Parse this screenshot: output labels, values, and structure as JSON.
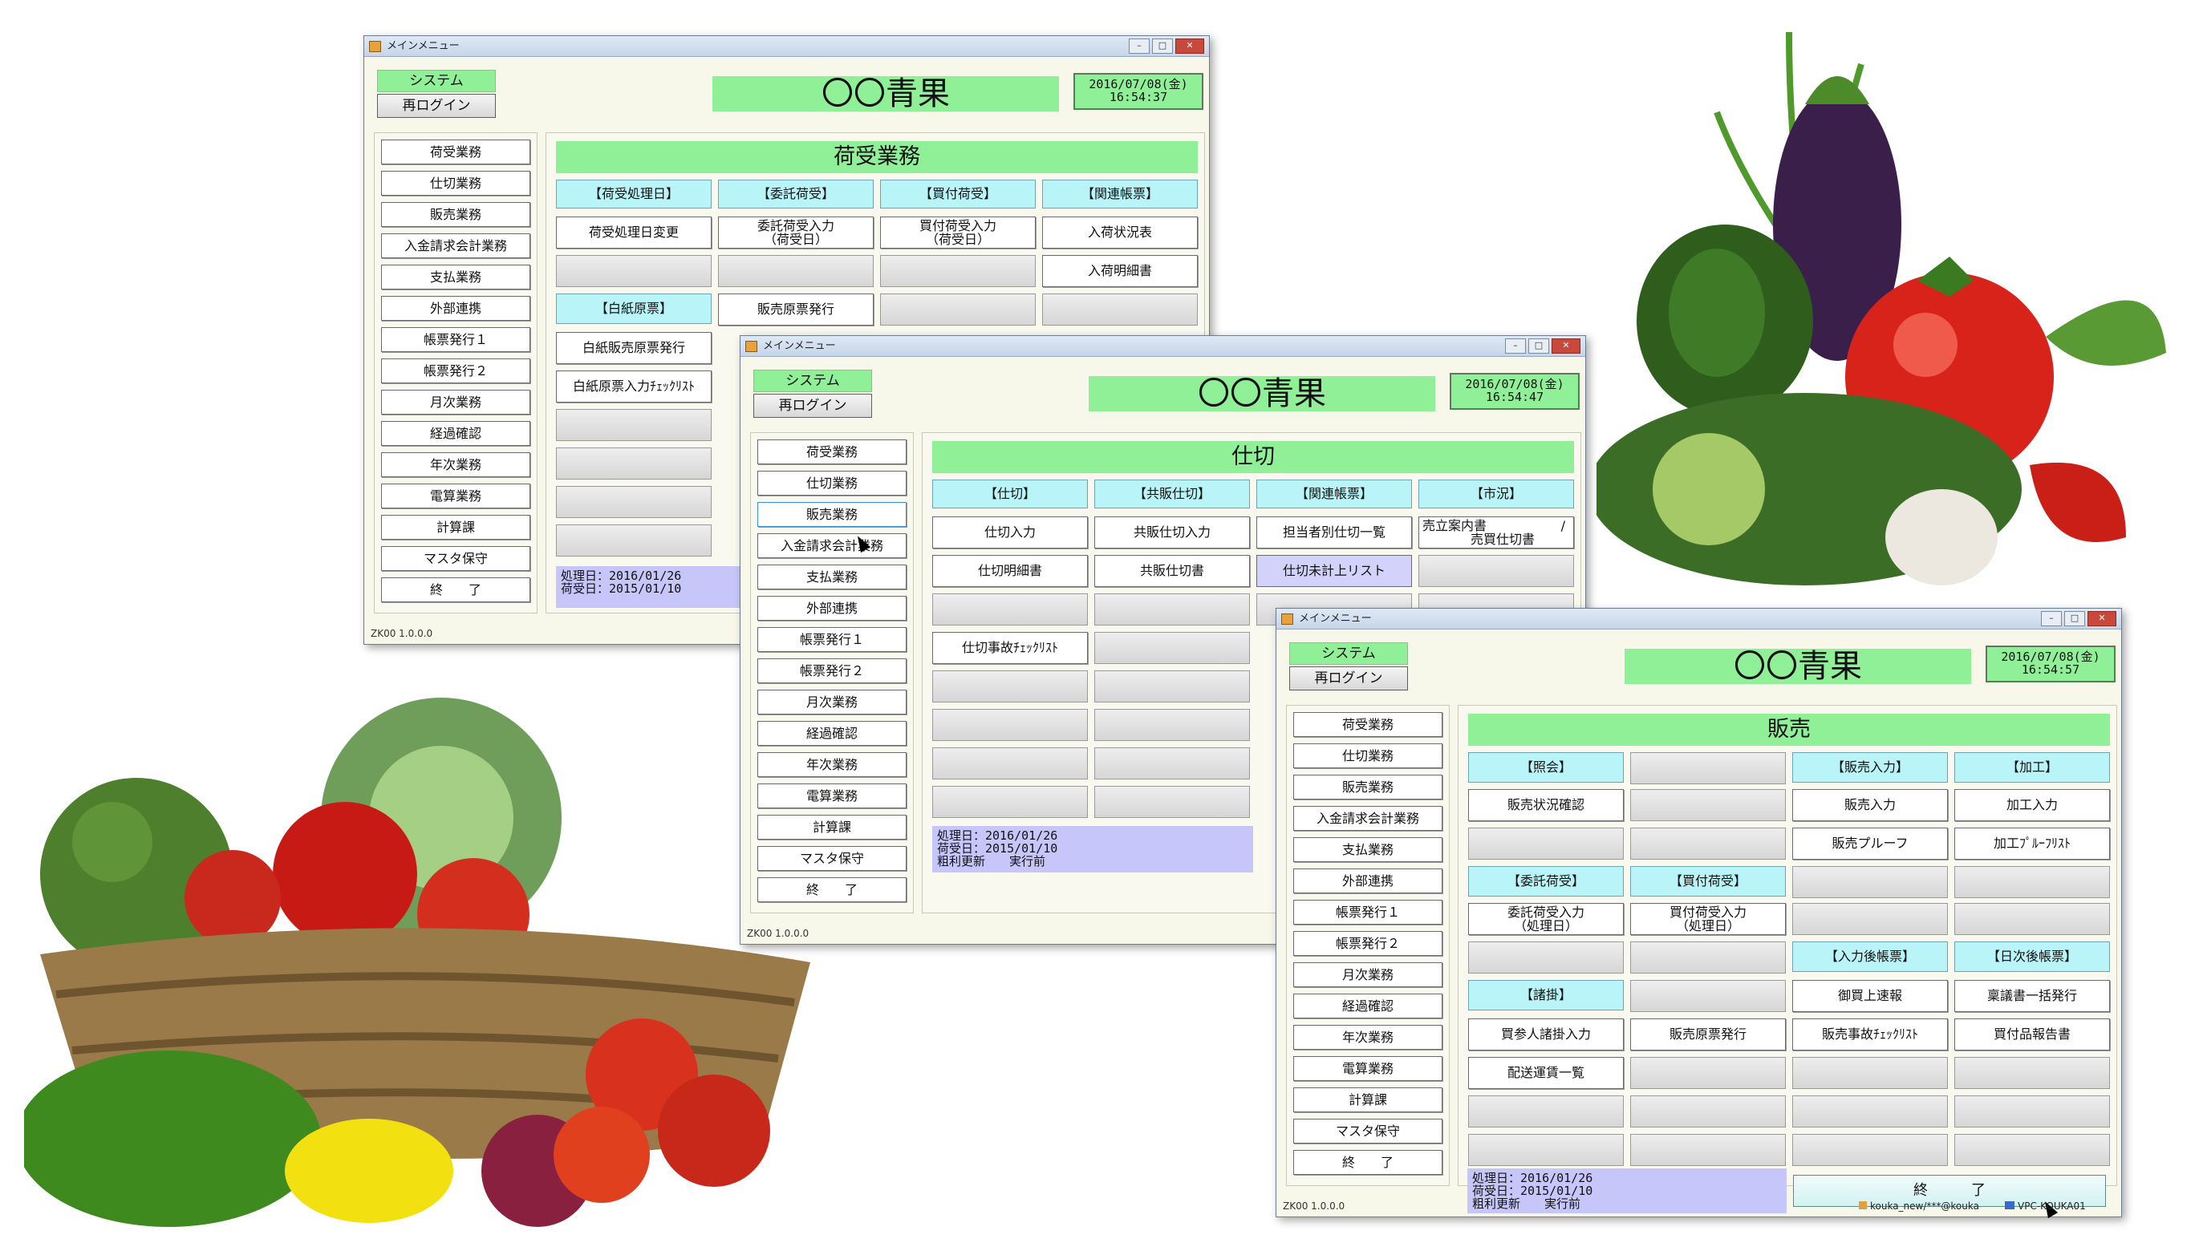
{
  "win1": {
    "title": "メインメニュー",
    "system_label": "システム",
    "relogin_label": "再ログイン",
    "company": "〇〇青果",
    "clock": [
      "2016/07/08(金)",
      "16:54:37"
    ],
    "menu": [
      "荷受業務",
      "仕切業務",
      "販売業務",
      "入金請求会計業務",
      "支払業務",
      "外部連携",
      "帳票発行１",
      "帳票発行２",
      "月次業務",
      "経過確認",
      "年次業務",
      "電算業務",
      "計算課",
      "マスタ保守",
      "終　　了"
    ],
    "section_title": "荷受業務",
    "cells": {
      "c0_0": "【荷受処理日】",
      "c0_1": "【委託荷受】",
      "c0_2": "【買付荷受】",
      "c0_3": "【関連帳票】",
      "c1_0": "荷受処理日変更",
      "c1_1a": "委託荷受入力",
      "c1_1b": "（荷受日）",
      "c1_2a": "買付荷受入力",
      "c1_2b": "（荷受日）",
      "c1_3": "入荷状況表",
      "c2_3": "入荷明細書",
      "c3_0": "【白紙原票】",
      "c3_1": "販売原票発行",
      "c4_0": "白紙販売原票発行",
      "c5_0": "白紙原票入力ﾁｪｯｸﾘｽﾄ"
    },
    "status": [
      "処理日：2016/01/26",
      "荷受日：2015/01/10"
    ],
    "version": "ZK00  1.0.0.0"
  },
  "win2": {
    "title": "メインメニュー",
    "system_label": "システム",
    "relogin_label": "再ログイン",
    "company": "〇〇青果",
    "clock": [
      "2016/07/08(金)",
      "16:54:47"
    ],
    "menu": [
      "荷受業務",
      "仕切業務",
      "販売業務",
      "入金請求会計業務",
      "支払業務",
      "外部連携",
      "帳票発行１",
      "帳票発行２",
      "月次業務",
      "経過確認",
      "年次業務",
      "電算業務",
      "計算課",
      "マスタ保守",
      "終　　了"
    ],
    "section_title": "仕切",
    "cells": {
      "c0_0": "【仕切】",
      "c0_1": "【共販仕切】",
      "c0_2": "【関連帳票】",
      "c0_3": "【市況】",
      "c1_0": "仕切入力",
      "c1_1": "共販仕切入力",
      "c1_2": "担当者別仕切一覧",
      "c1_3a": "売立案内書",
      "c1_3slash": "/",
      "c1_3b": "売買仕切書",
      "c2_0": "仕切明細書",
      "c2_1": "共販仕切書",
      "c2_2": "仕切未計上リスト",
      "c4_0": "仕切事故ﾁｪｯｸﾘｽﾄ"
    },
    "status": [
      "処理日：2016/01/26",
      "荷受日：2015/01/10",
      "粗利更新　　実行前"
    ],
    "version": "ZK00  1.0.0.0"
  },
  "win3": {
    "title": "メインメニュー",
    "system_label": "システム",
    "relogin_label": "再ログイン",
    "company": "〇〇青果",
    "clock": [
      "2016/07/08(金)",
      "16:54:57"
    ],
    "menu": [
      "荷受業務",
      "仕切業務",
      "販売業務",
      "入金請求会計業務",
      "支払業務",
      "外部連携",
      "帳票発行１",
      "帳票発行２",
      "月次業務",
      "経過確認",
      "年次業務",
      "電算業務",
      "計算課",
      "マスタ保守",
      "終　　了"
    ],
    "section_title": "販売",
    "cells": {
      "c0_0": "【照会】",
      "c0_2": "【販売入力】",
      "c0_3": "【加工】",
      "c1_0": "販売状況確認",
      "c1_2": "販売入力",
      "c1_3": "加工入力",
      "c2_2": "販売プルーフ",
      "c2_3": "加工ﾌﾟﾙｰﾌﾘｽﾄ",
      "c3_0": "【委託荷受】",
      "c3_1": "【買付荷受】",
      "c4_0a": "委託荷受入力",
      "c4_0b": "（処理日）",
      "c4_1a": "買付荷受入力",
      "c4_1b": "（処理日）",
      "c5_2": "【入力後帳票】",
      "c5_3": "【日次後帳票】",
      "c6_0": "【諸掛】",
      "c6_2": "御買上速報",
      "c6_3": "稟議書一括発行",
      "c7_0": "買参人諸掛入力",
      "c7_1": "販売原票発行",
      "c7_2": "販売事故ﾁｪｯｸﾘｽﾄ",
      "c7_3": "買付品報告書",
      "c8_0": "配送運賃一覧"
    },
    "status": [
      "処理日：2016/01/26",
      "荷受日：2015/01/10",
      "粗利更新　　実行前"
    ],
    "exit_label": "終　　　了",
    "version": "ZK00  1.0.0.0",
    "statusbar_user": "kouka_new/***@kouka",
    "statusbar_pc": "VPC-KOUKA01"
  },
  "colors": {
    "green": "#90f098",
    "cyan": "#b8f4f8",
    "lavender": "#c6c6fa",
    "window_bg": "#f7f7ea"
  }
}
